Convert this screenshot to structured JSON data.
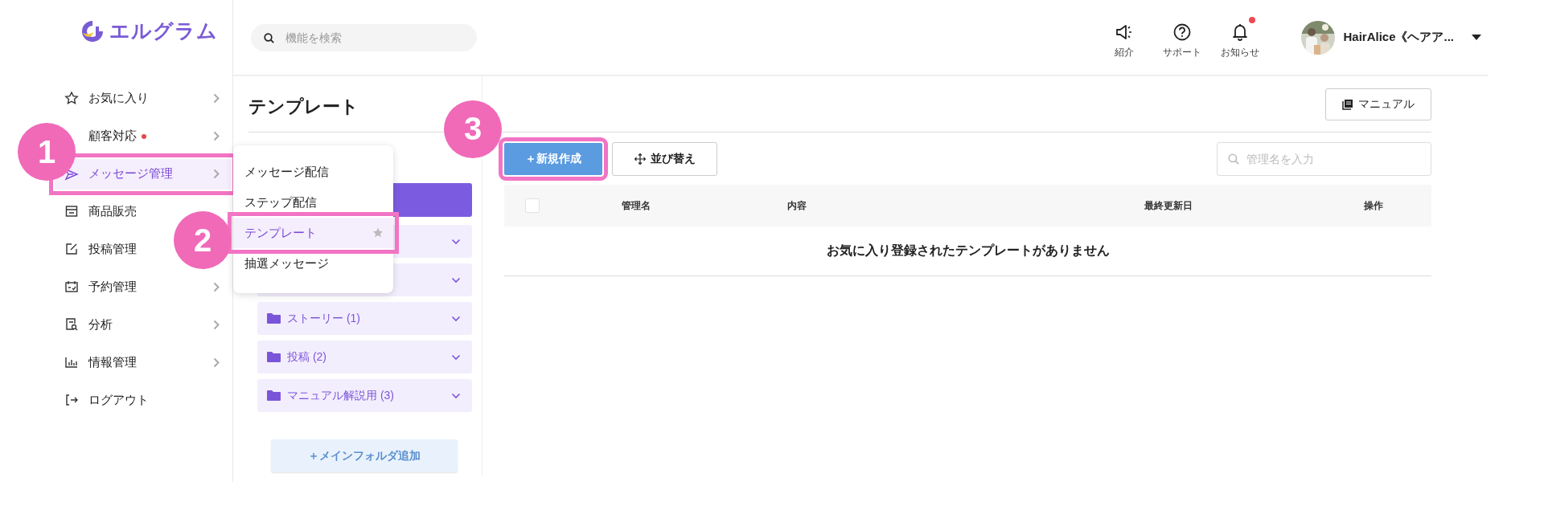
{
  "logo": {
    "text": "エルグラム"
  },
  "search": {
    "placeholder": "機能を検索"
  },
  "header_icons": [
    {
      "kind": "megaphone",
      "label": "紹介",
      "unread": false
    },
    {
      "kind": "help",
      "label": "サポート",
      "unread": false
    },
    {
      "kind": "bell",
      "label": "お知らせ",
      "unread": true
    }
  ],
  "account": {
    "name": "HairAlice《ヘアア..."
  },
  "sidebar": {
    "items": [
      {
        "kind": "star",
        "label": "お気に入り",
        "expandable": true,
        "selected": false,
        "dot": false
      },
      {
        "label": "顧客対応",
        "expandable": true,
        "selected": false,
        "dot": true
      },
      {
        "kind": "send",
        "label": "メッセージ管理",
        "expandable": true,
        "selected": true,
        "dot": false,
        "callout": "1"
      },
      {
        "kind": "shop",
        "label": "商品販売",
        "expandable": false,
        "selected": false,
        "dot": false
      },
      {
        "kind": "edit",
        "label": "投稿管理",
        "expandable": false,
        "selected": false,
        "dot": false
      },
      {
        "kind": "calendar",
        "label": "予約管理",
        "expandable": true,
        "selected": false,
        "dot": false
      },
      {
        "kind": "report",
        "label": "分析",
        "expandable": true,
        "selected": false,
        "dot": false
      },
      {
        "kind": "chart",
        "label": "情報管理",
        "expandable": true,
        "selected": false,
        "dot": false
      },
      {
        "kind": "logout",
        "label": "ログアウト",
        "expandable": false,
        "selected": false,
        "dot": false
      }
    ]
  },
  "submenu": {
    "items": [
      {
        "label": "メッセージ配信",
        "selected": false
      },
      {
        "label": "ステップ配信",
        "selected": false
      },
      {
        "label": "テンプレート",
        "selected": true,
        "callout": "2"
      },
      {
        "label": "抽選メッセージ",
        "selected": false
      }
    ]
  },
  "page": {
    "title": "テンプレート",
    "manual_button": "マニュアル"
  },
  "folders": {
    "items": [
      {
        "expanded": false
      },
      {
        "expanded": false
      },
      {
        "label": "ストーリー (1)",
        "expanded": false
      },
      {
        "label": "投稿 (2)",
        "expanded": false
      },
      {
        "label": "マニュアル解説用 (3)",
        "expanded": false
      }
    ],
    "add_button": "＋メインフォルダ追加"
  },
  "toolbar": {
    "new_button": {
      "label": "＋新規作成",
      "callout": "3"
    },
    "sort_button": "並び替え",
    "filter": {
      "placeholder": "管理名を入力"
    }
  },
  "table": {
    "select_all_checked": false,
    "columns": [
      "管理名",
      "内容",
      "最終更新日",
      "操作"
    ],
    "empty_message": "お気に入り登録されたテンプレートがありません"
  }
}
